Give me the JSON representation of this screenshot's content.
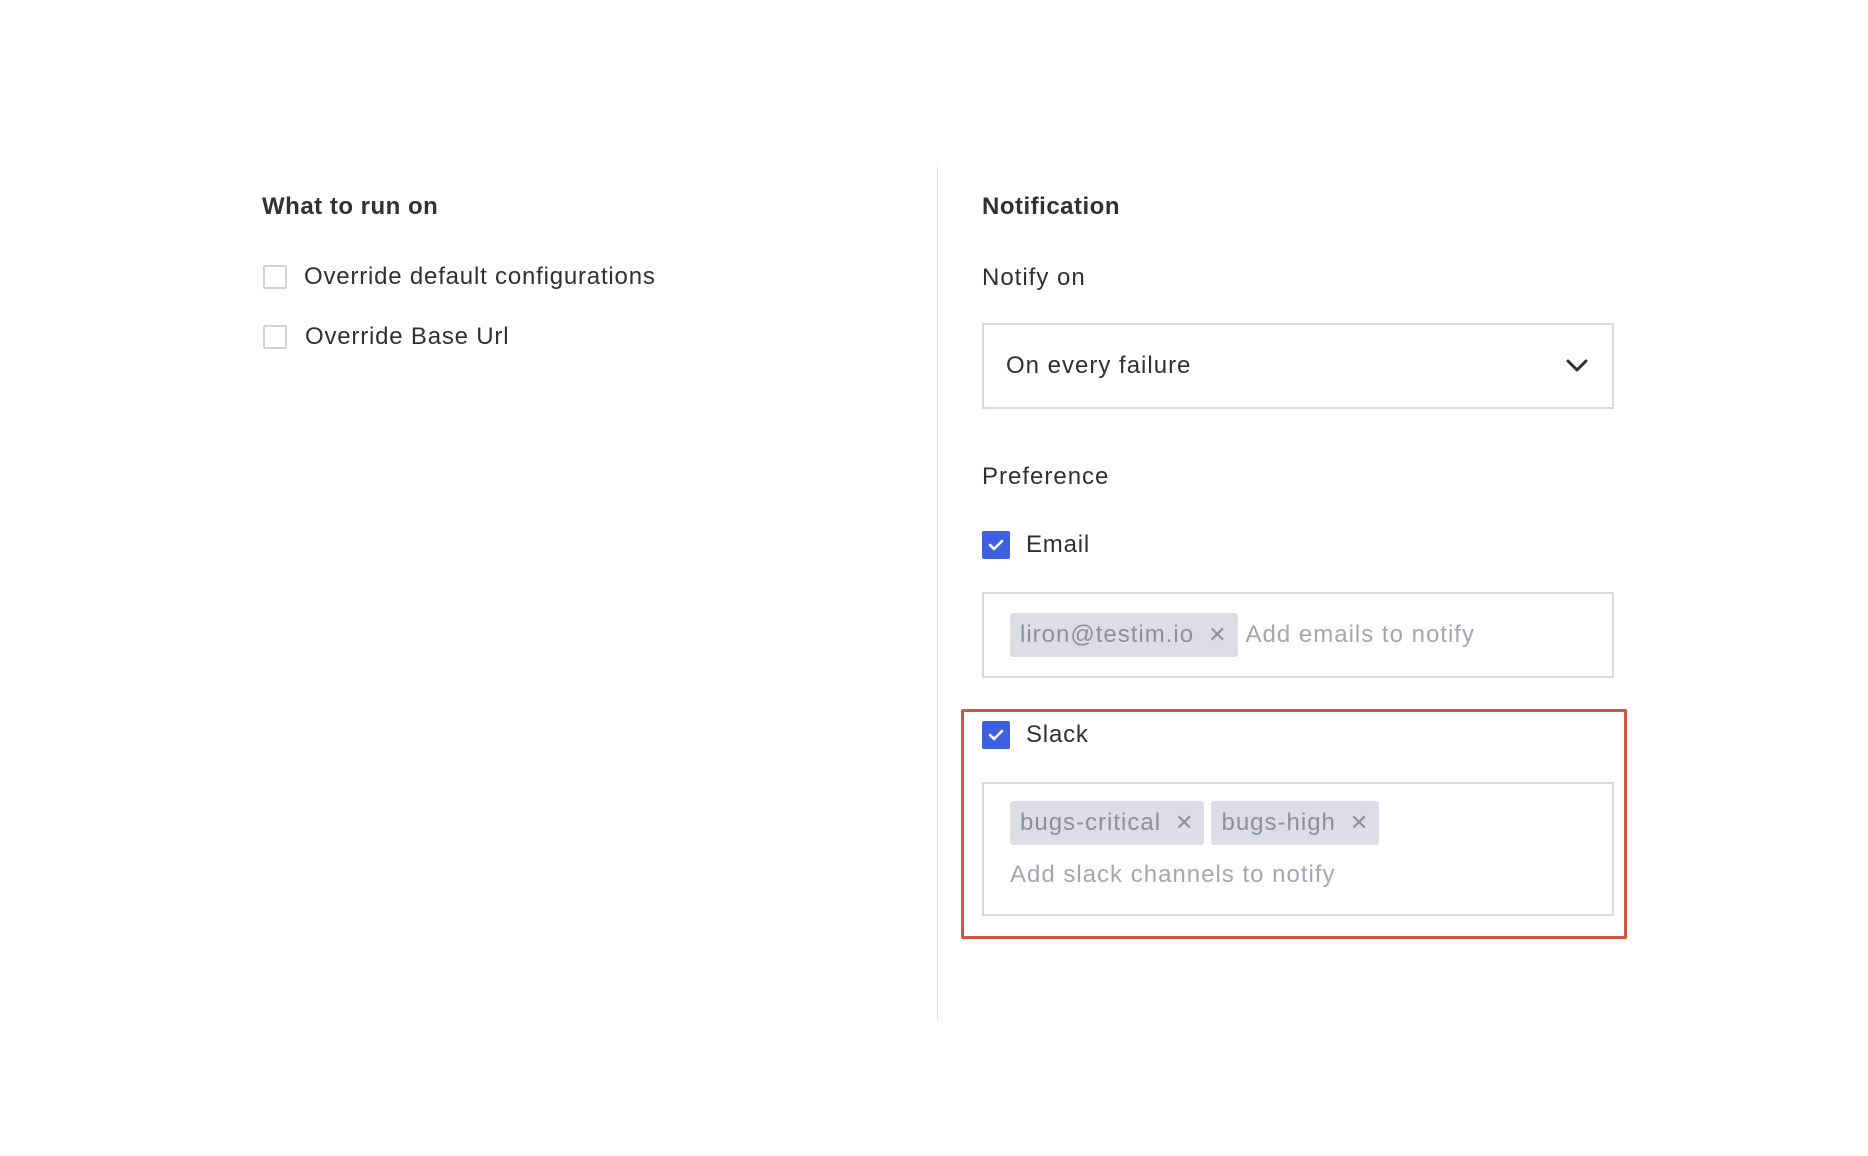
{
  "left_panel": {
    "title": "What to run on",
    "options": [
      {
        "label": "Override default configurations",
        "checked": false
      },
      {
        "label": "Override Base Url",
        "checked": false
      }
    ]
  },
  "right_panel": {
    "title": "Notification",
    "notify_on": {
      "label": "Notify on",
      "selected": "On every failure"
    },
    "preference": {
      "label": "Preference",
      "email": {
        "label": "Email",
        "checked": true,
        "tags": [
          "liron@testim.io"
        ],
        "placeholder": "Add emails to notify"
      },
      "slack": {
        "label": "Slack",
        "checked": true,
        "tags": [
          "bugs-critical",
          "bugs-high"
        ],
        "placeholder": "Add slack channels to notify"
      }
    }
  },
  "colors": {
    "accent": "#3e5fe0",
    "highlight": "#d9513f",
    "tag_bg": "#dcdde6"
  }
}
